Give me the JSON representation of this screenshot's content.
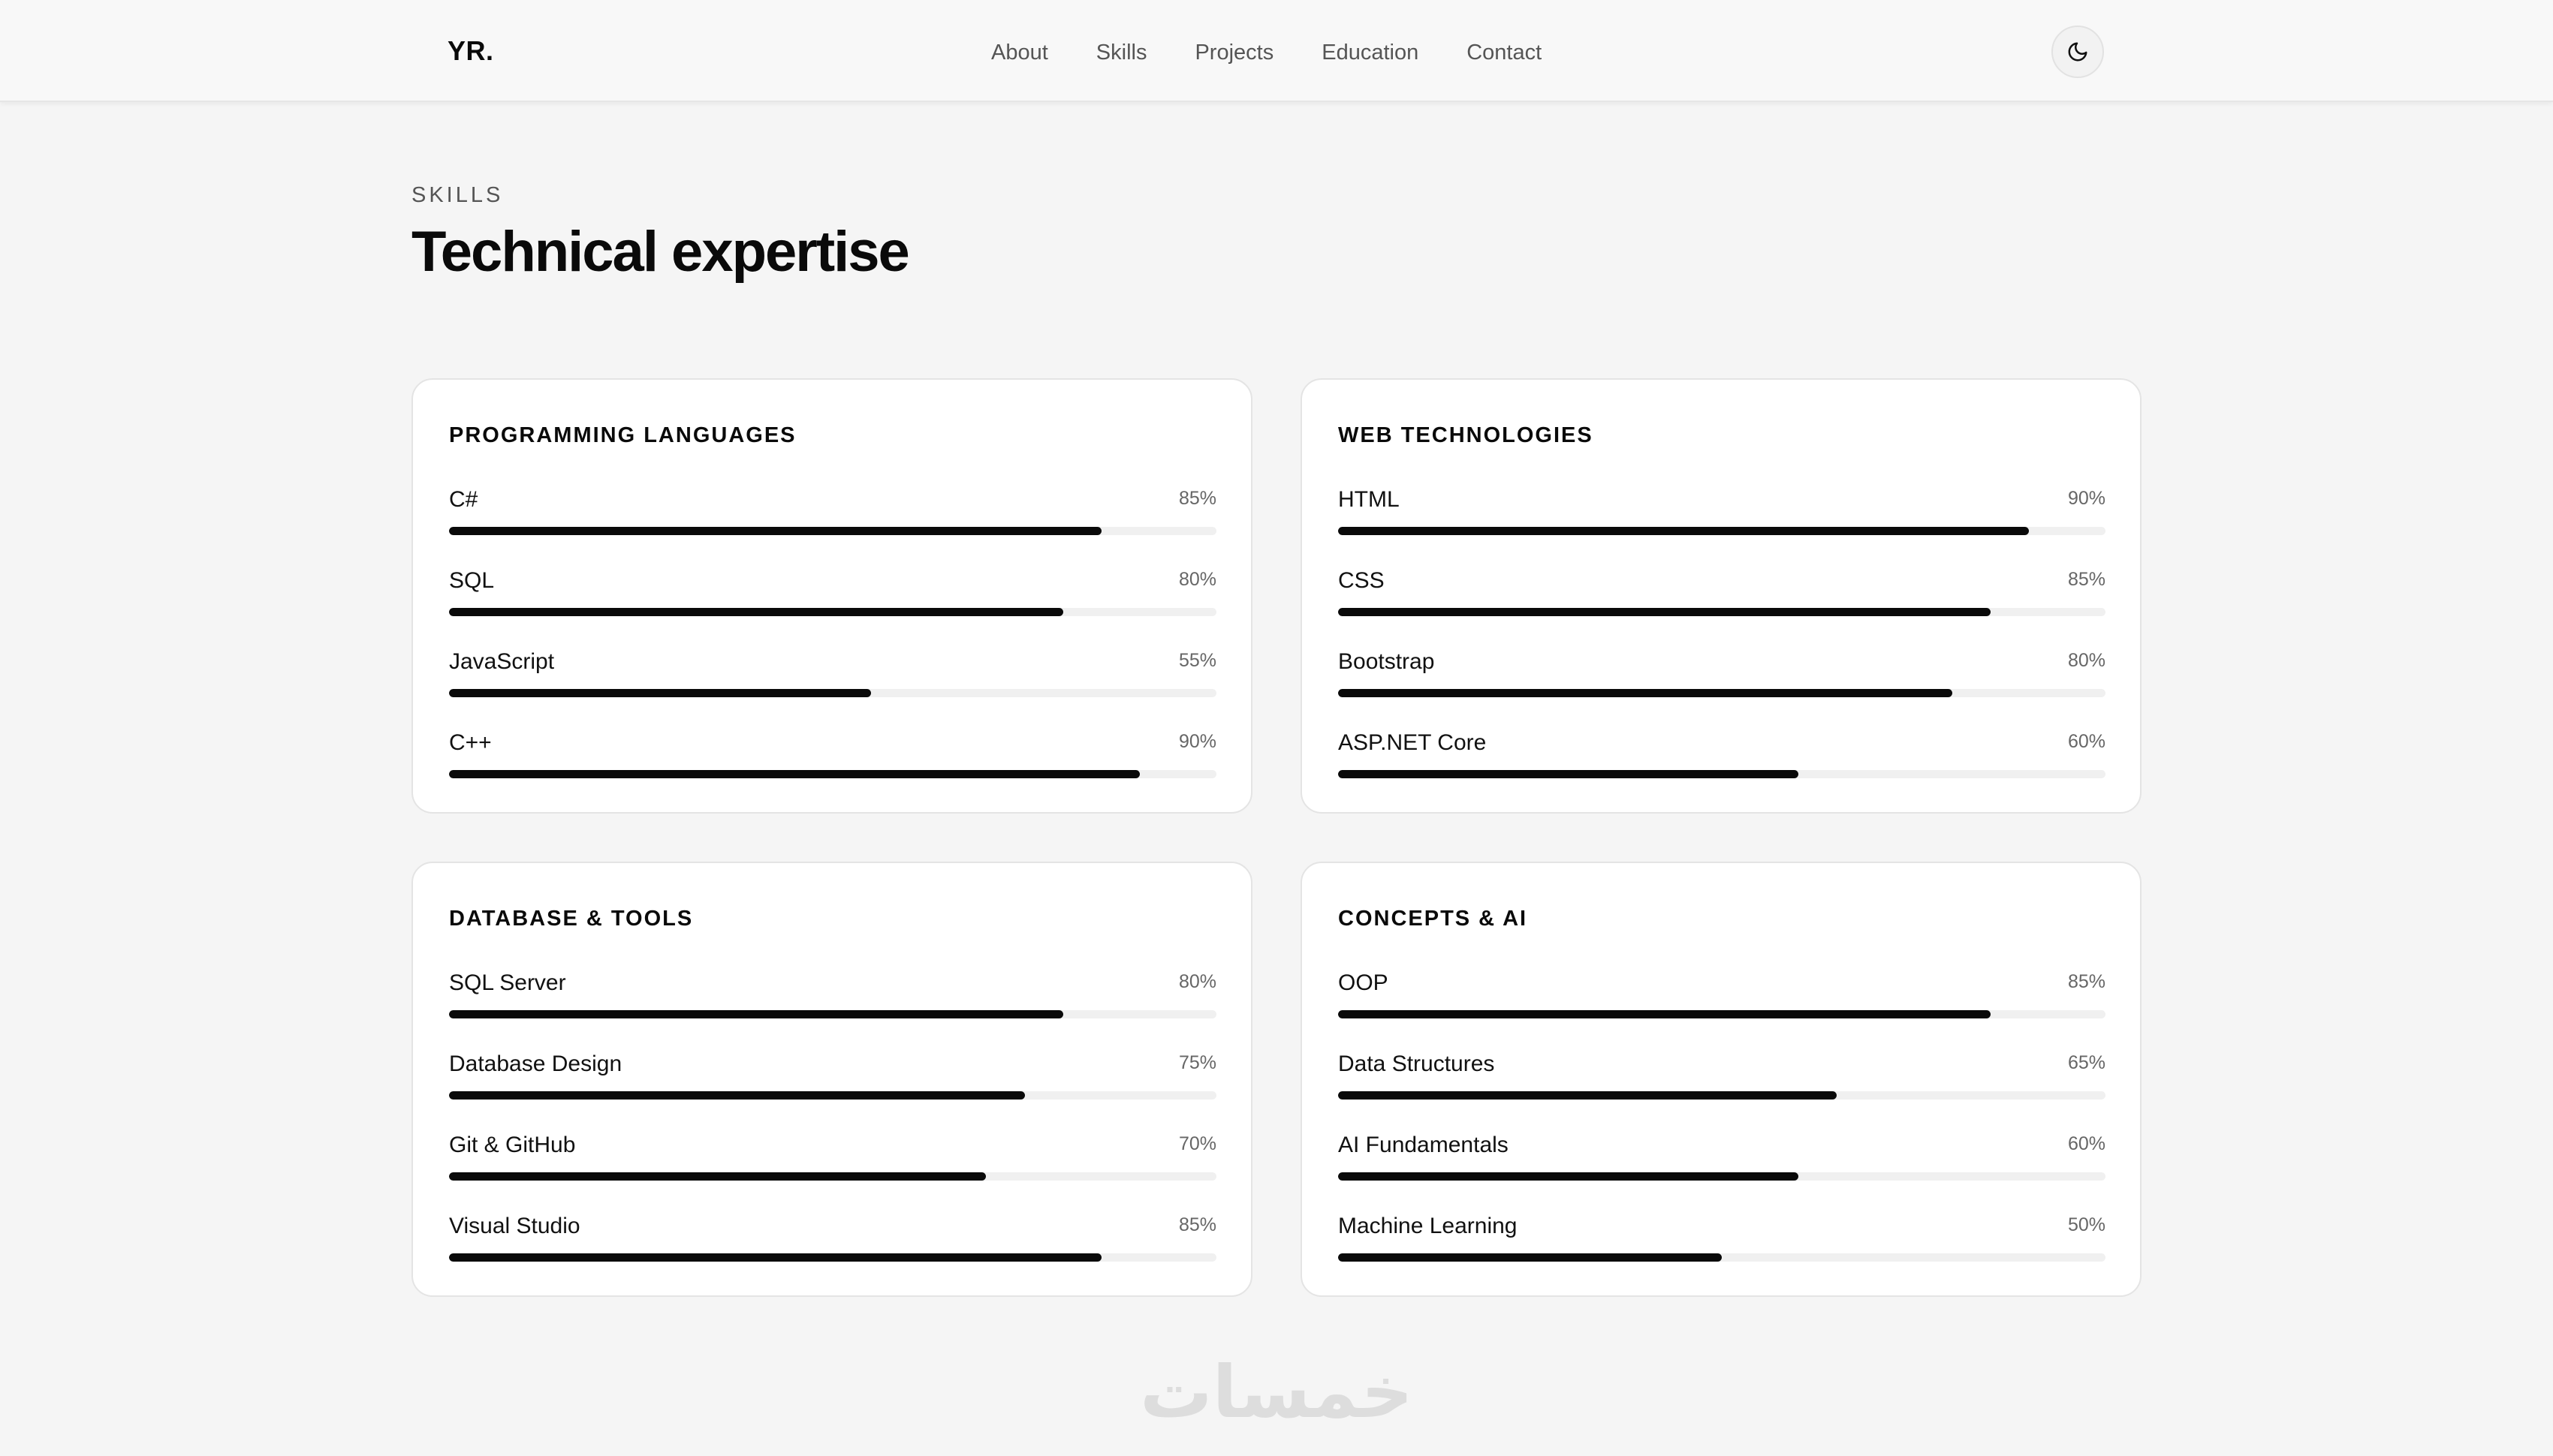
{
  "nav": {
    "logo": "YR.",
    "links": [
      "About",
      "Skills",
      "Projects",
      "Education",
      "Contact"
    ],
    "theme_icon": "moon-icon"
  },
  "section": {
    "eyebrow": "SKILLS",
    "title": "Technical expertise"
  },
  "cards": [
    {
      "title": "PROGRAMMING LANGUAGES",
      "skills": [
        {
          "name": "C#",
          "percent": "85%",
          "level": 85
        },
        {
          "name": "SQL",
          "percent": "80%",
          "level": 80
        },
        {
          "name": "JavaScript",
          "percent": "55%",
          "level": 55
        },
        {
          "name": "C++",
          "percent": "90%",
          "level": 90
        }
      ]
    },
    {
      "title": "WEB TECHNOLOGIES",
      "skills": [
        {
          "name": "HTML",
          "percent": "90%",
          "level": 90
        },
        {
          "name": "CSS",
          "percent": "85%",
          "level": 85
        },
        {
          "name": "Bootstrap",
          "percent": "80%",
          "level": 80
        },
        {
          "name": "ASP.NET Core",
          "percent": "60%",
          "level": 60
        }
      ]
    },
    {
      "title": "DATABASE & TOOLS",
      "skills": [
        {
          "name": "SQL Server",
          "percent": "80%",
          "level": 80
        },
        {
          "name": "Database Design",
          "percent": "75%",
          "level": 75
        },
        {
          "name": "Git & GitHub",
          "percent": "70%",
          "level": 70
        },
        {
          "name": "Visual Studio",
          "percent": "85%",
          "level": 85
        }
      ]
    },
    {
      "title": "CONCEPTS & AI",
      "skills": [
        {
          "name": "OOP",
          "percent": "85%",
          "level": 85
        },
        {
          "name": "Data Structures",
          "percent": "65%",
          "level": 65
        },
        {
          "name": "AI Fundamentals",
          "percent": "60%",
          "level": 60
        },
        {
          "name": "Machine Learning",
          "percent": "50%",
          "level": 50
        }
      ]
    }
  ],
  "watermark": "خمسات",
  "colors": {
    "accent": "#0a0a0a",
    "track": "#f0f0f0",
    "background": "#f5f5f5",
    "card": "#ffffff"
  }
}
